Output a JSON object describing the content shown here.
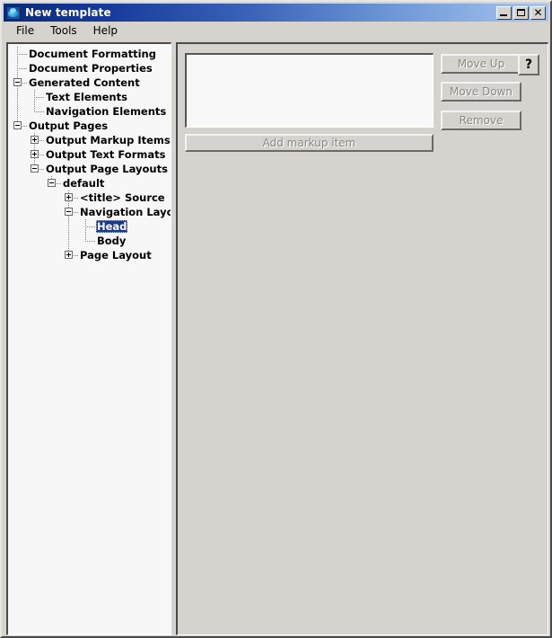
{
  "window": {
    "title": "New template",
    "icon": "app-globe-icon",
    "controls": {
      "minimize": "minimize-icon",
      "maximize": "maximize-icon",
      "close": "close-icon"
    }
  },
  "menubar": {
    "items": [
      {
        "label": "File"
      },
      {
        "label": "Tools"
      },
      {
        "label": "Help"
      }
    ]
  },
  "tree": {
    "nodes": [
      {
        "label": "Document Formatting",
        "depth": 0,
        "toggle": "none",
        "selected": false
      },
      {
        "label": "Document Properties",
        "depth": 0,
        "toggle": "none",
        "selected": false
      },
      {
        "label": "Generated Content",
        "depth": 0,
        "toggle": "minus",
        "selected": false
      },
      {
        "label": "Text Elements",
        "depth": 1,
        "toggle": "none",
        "selected": false
      },
      {
        "label": "Navigation Elements",
        "depth": 1,
        "toggle": "none",
        "selected": false
      },
      {
        "label": "Output Pages",
        "depth": 0,
        "toggle": "minus",
        "selected": false
      },
      {
        "label": "Output Markup Items",
        "depth": 1,
        "toggle": "plus",
        "selected": false
      },
      {
        "label": "Output Text Formats",
        "depth": 1,
        "toggle": "plus",
        "selected": false
      },
      {
        "label": "Output Page Layouts",
        "depth": 1,
        "toggle": "minus",
        "selected": false
      },
      {
        "label": "default",
        "depth": 2,
        "toggle": "minus",
        "selected": false
      },
      {
        "label": "<title> Source",
        "depth": 3,
        "toggle": "plus",
        "selected": false
      },
      {
        "label": "Navigation Layout",
        "depth": 3,
        "toggle": "minus",
        "selected": false
      },
      {
        "label": "Head",
        "depth": 4,
        "toggle": "none",
        "selected": true
      },
      {
        "label": "Body",
        "depth": 4,
        "toggle": "none",
        "selected": false
      },
      {
        "label": "Page Layout",
        "depth": 3,
        "toggle": "plus",
        "selected": false
      }
    ]
  },
  "editor": {
    "markup_list": {
      "items": []
    },
    "add_markup_label": "Add markup item",
    "move_up_label": "Move Up",
    "move_down_label": "Move Down",
    "remove_label": "Remove",
    "help_label": "?"
  },
  "colors": {
    "titlebar_start": "#0b2a78",
    "titlebar_end": "#a8c6ef",
    "selection": "#1c3a8c",
    "face": "#d6d3ce",
    "field": "#f7f7f7",
    "disabled_text": "#8b8882"
  }
}
